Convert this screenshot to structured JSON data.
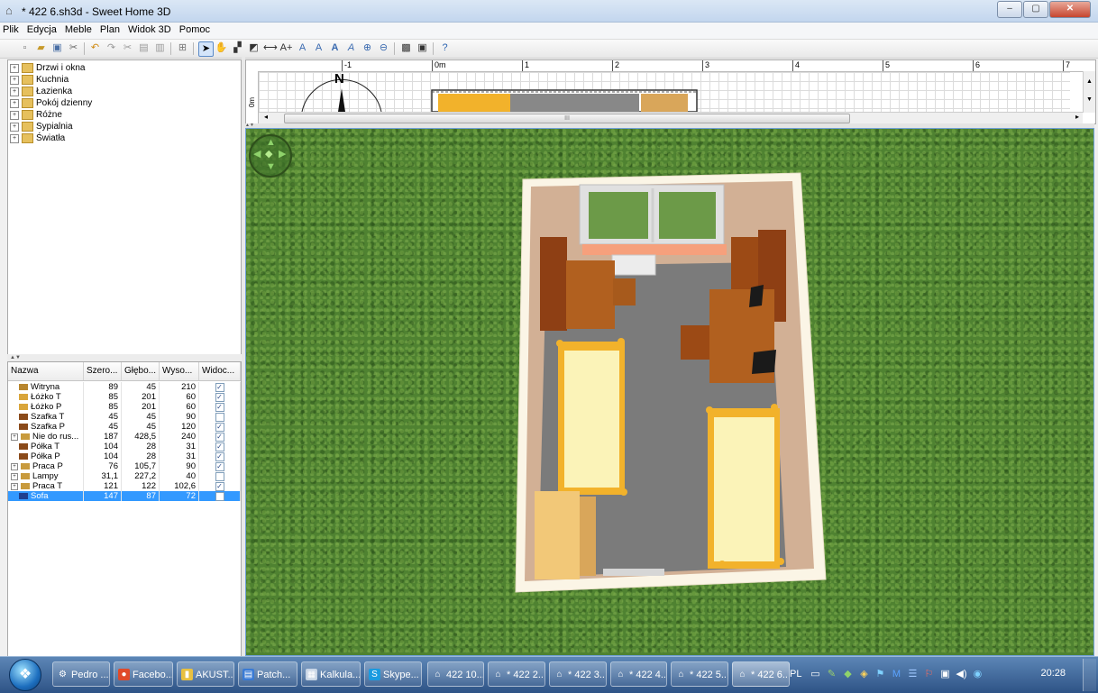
{
  "window": {
    "title": "* 422 6.sh3d - Sweet Home 3D"
  },
  "window_controls": {
    "minimize": "–",
    "maximize": "▢",
    "close": "✕"
  },
  "menu": [
    "Plik",
    "Edycja",
    "Meble",
    "Plan",
    "Widok 3D",
    "Pomoc"
  ],
  "catalog": {
    "categories": [
      "Drzwi i okna",
      "Kuchnia",
      "Łazienka",
      "Pokój dzienny",
      "Różne",
      "Sypialnia",
      "Światła"
    ]
  },
  "furniture_table": {
    "columns": [
      "Nazwa",
      "Szero...",
      "Głębo...",
      "Wyso...",
      "Widoc..."
    ],
    "rows": [
      {
        "name": "Witryna",
        "width": "89",
        "depth": "45",
        "height": "210",
        "visible": true,
        "group": false,
        "icon_color": "#b8862e"
      },
      {
        "name": "Łóżko T",
        "width": "85",
        "depth": "201",
        "height": "60",
        "visible": true,
        "group": false,
        "icon_color": "#d9a53a"
      },
      {
        "name": "Łóżko P",
        "width": "85",
        "depth": "201",
        "height": "60",
        "visible": true,
        "group": false,
        "icon_color": "#d9a53a"
      },
      {
        "name": "Szafka T",
        "width": "45",
        "depth": "45",
        "height": "90",
        "visible": false,
        "group": false,
        "icon_color": "#8a4a1a"
      },
      {
        "name": "Szafka P",
        "width": "45",
        "depth": "45",
        "height": "120",
        "visible": true,
        "group": false,
        "icon_color": "#8a4a1a"
      },
      {
        "name": "Nie do rus...",
        "width": "187",
        "depth": "428,5",
        "height": "240",
        "visible": true,
        "group": true,
        "icon_color": "#c89a3c"
      },
      {
        "name": "Półka T",
        "width": "104",
        "depth": "28",
        "height": "31",
        "visible": true,
        "group": false,
        "icon_color": "#8a4a1a"
      },
      {
        "name": "Półka P",
        "width": "104",
        "depth": "28",
        "height": "31",
        "visible": true,
        "group": false,
        "icon_color": "#8a4a1a"
      },
      {
        "name": "Praca P",
        "width": "76",
        "depth": "105,7",
        "height": "90",
        "visible": true,
        "group": true,
        "icon_color": "#c89a3c"
      },
      {
        "name": "Lampy",
        "width": "31,1",
        "depth": "227,2",
        "height": "40",
        "visible": false,
        "group": true,
        "icon_color": "#c89a3c"
      },
      {
        "name": "Praca T",
        "width": "121",
        "depth": "122",
        "height": "102,6",
        "visible": true,
        "group": true,
        "icon_color": "#c89a3c"
      },
      {
        "name": "Sofa",
        "width": "147",
        "depth": "87",
        "height": "72",
        "visible": false,
        "group": false,
        "icon_color": "#1f3f8f",
        "selected": true
      }
    ]
  },
  "plan": {
    "ruler_labels": [
      "-1",
      "0m",
      "1",
      "2",
      "3",
      "4",
      "5",
      "6",
      "7"
    ],
    "left_ruler_label": "0m",
    "compass_label": "N",
    "scroll_thumb": "III"
  },
  "taskbar": {
    "buttons": [
      {
        "label": "Pedro ...",
        "icon": "⚙",
        "icon_bg": "#ffffff00"
      },
      {
        "label": "Facebo...",
        "icon": "●",
        "icon_bg": "#e04a2a"
      },
      {
        "label": "AKUST...",
        "icon": "▮",
        "icon_bg": "#e8c040"
      },
      {
        "label": "Patch...",
        "icon": "▤",
        "icon_bg": "#3a7bd5"
      },
      {
        "label": "Kalkula...",
        "icon": "▦",
        "icon_bg": "#c9d6e6"
      },
      {
        "label": "Skype...",
        "icon": "S",
        "icon_bg": "#1a9be0"
      },
      {
        "label": "422 10....",
        "icon": "⌂",
        "icon_bg": "#ffffff00"
      },
      {
        "label": "* 422 2....",
        "icon": "⌂",
        "icon_bg": "#ffffff00"
      },
      {
        "label": "* 422 3....",
        "icon": "⌂",
        "icon_bg": "#ffffff00"
      },
      {
        "label": "* 422 4....",
        "icon": "⌂",
        "icon_bg": "#ffffff00"
      },
      {
        "label": "* 422 5....",
        "icon": "⌂",
        "icon_bg": "#ffffff00"
      },
      {
        "label": "* 422 6....",
        "icon": "⌂",
        "icon_bg": "#ffffff00",
        "active": true
      }
    ],
    "language": "PL",
    "clock": "20:28"
  },
  "colors": {
    "selection": "#3399ff",
    "grass": "#4f8231",
    "floor": "#7a7a7a",
    "wood": "#a8561c",
    "bed_frame": "#f2b22b",
    "mattress": "#fbf3b8"
  }
}
